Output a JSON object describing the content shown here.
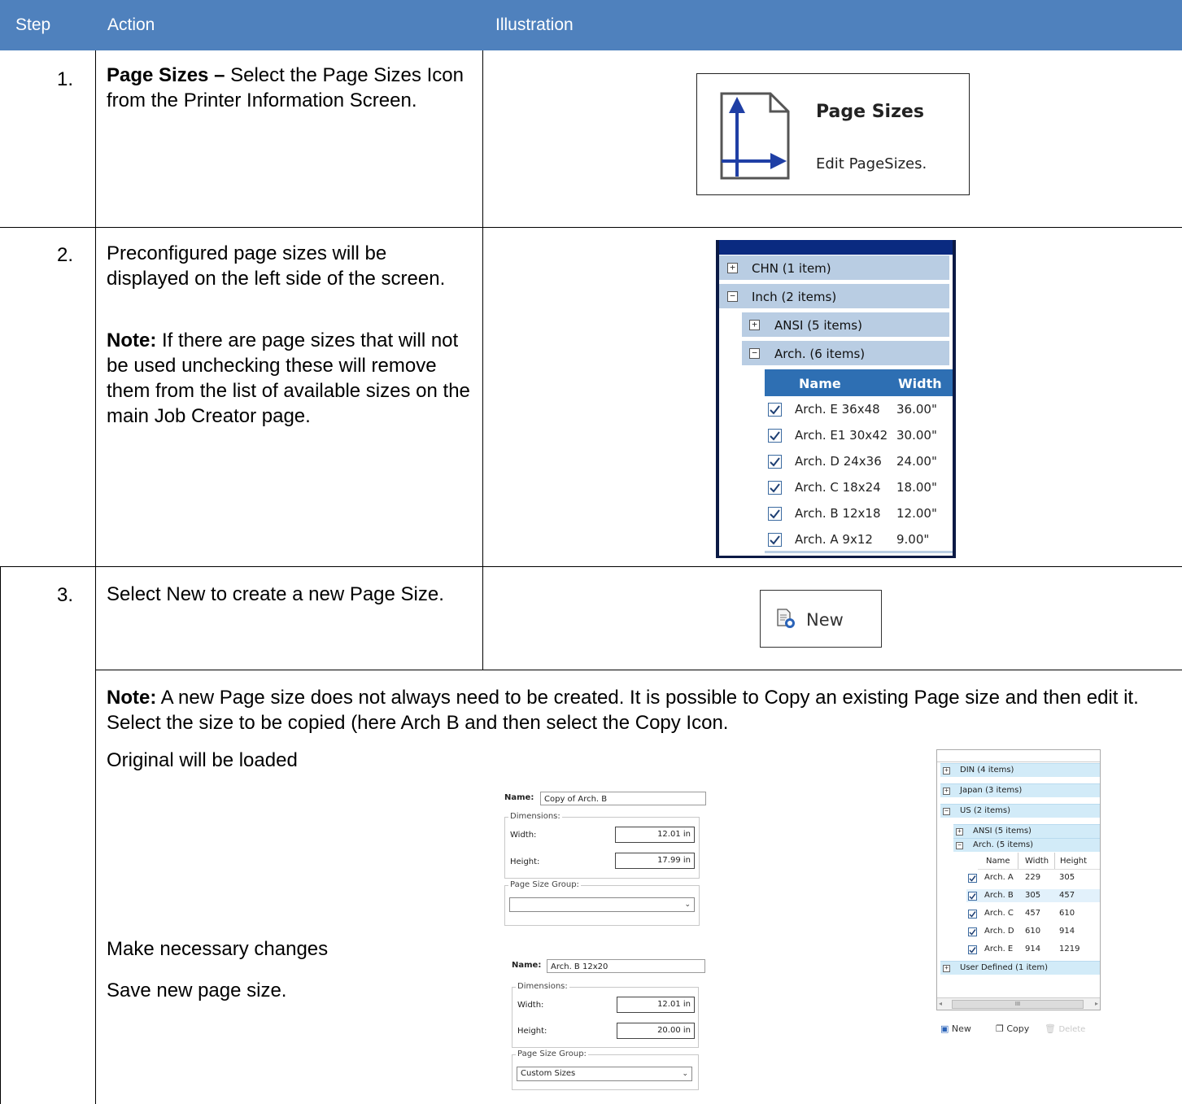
{
  "header": {
    "step": "Step",
    "action": "Action",
    "illustration": "Illustration"
  },
  "rows": [
    {
      "num": "1.",
      "bold": "Page Sizes –",
      "text": " Select the Page Sizes Icon from the Printer Information Screen."
    },
    {
      "num": "2.",
      "text": "Preconfigured page sizes will be displayed on the left side of the screen.",
      "note_bold": "Note:",
      "note": " If there are page sizes that will not be used unchecking these will remove them from the list of available sizes on the main Job Creator page."
    },
    {
      "num": "3.",
      "text": "Select New to create a new Page Size."
    }
  ],
  "note_row": {
    "bold": "Note:",
    "text": " A new Page size does not always need to be created. It is possible to Copy an existing Page size and then edit it. Select the size to be copied (here Arch B and then select the Copy Icon.",
    "original": "Original will be loaded",
    "changes": "Make necessary changes",
    "save": "Save new page size."
  },
  "pagesizes_tile": {
    "title": "Page Sizes",
    "subtitle": "Edit PageSizes.",
    "icon": "page-size-icon"
  },
  "tree2": {
    "groups": [
      {
        "label": "CHN (1 item)",
        "sign": "+"
      },
      {
        "label": "Inch (2 items)",
        "sign": "−"
      },
      {
        "label": "ANSI (5 items)",
        "sign": "+"
      },
      {
        "label": "Arch. (6 items)",
        "sign": "−"
      }
    ],
    "columns": [
      "Name",
      "Width"
    ],
    "rows": [
      {
        "name": "Arch. E 36x48",
        "width": "36.00\""
      },
      {
        "name": "Arch. E1 30x42",
        "width": "30.00\""
      },
      {
        "name": "Arch. D 24x36",
        "width": "24.00\""
      },
      {
        "name": "Arch. C 18x24",
        "width": "18.00\""
      },
      {
        "name": "Arch. B 12x18",
        "width": "12.00\""
      },
      {
        "name": "Arch. A 9x12",
        "width": "9.00\""
      }
    ]
  },
  "new_button": {
    "label": "New",
    "icon": "new-document-icon"
  },
  "form1": {
    "name_label": "Name:",
    "name_value": "Copy of Arch. B",
    "dimensions": "Dimensions:",
    "width_label": "Width:",
    "width_value": "12.01 in",
    "height_label": "Height:",
    "height_value": "17.99 in",
    "group_label": "Page Size Group:",
    "group_value": ""
  },
  "form2": {
    "name_label": "Name:",
    "name_value": "Arch. B 12x20",
    "dimensions": "Dimensions:",
    "width_label": "Width:",
    "width_value": "12.01 in",
    "height_label": "Height:",
    "height_value": "20.00 in",
    "group_label": "Page Size Group:",
    "group_value": "Custom Sizes"
  },
  "tree3": {
    "groups": [
      {
        "label": "DIN (4 items)",
        "sign": "+"
      },
      {
        "label": "Japan (3 items)",
        "sign": "+"
      },
      {
        "label": "US (2 items)",
        "sign": "−"
      },
      {
        "label": "ANSI (5 items)",
        "sign": "+"
      },
      {
        "label": "Arch. (5 items)",
        "sign": "−"
      }
    ],
    "columns": [
      "Name",
      "Width",
      "Height"
    ],
    "rows": [
      {
        "name": "Arch. A",
        "width": "229",
        "height": "305"
      },
      {
        "name": "Arch. B",
        "width": "305",
        "height": "457"
      },
      {
        "name": "Arch. C",
        "width": "457",
        "height": "610"
      },
      {
        "name": "Arch. D",
        "width": "610",
        "height": "914"
      },
      {
        "name": "Arch. E",
        "width": "914",
        "height": "1219"
      }
    ],
    "user_defined": {
      "label": "User Defined (1 item)",
      "sign": "+"
    },
    "scroll_glyph": "III",
    "toolbar": {
      "new": "New",
      "copy": "Copy",
      "delete": "Delete"
    }
  }
}
